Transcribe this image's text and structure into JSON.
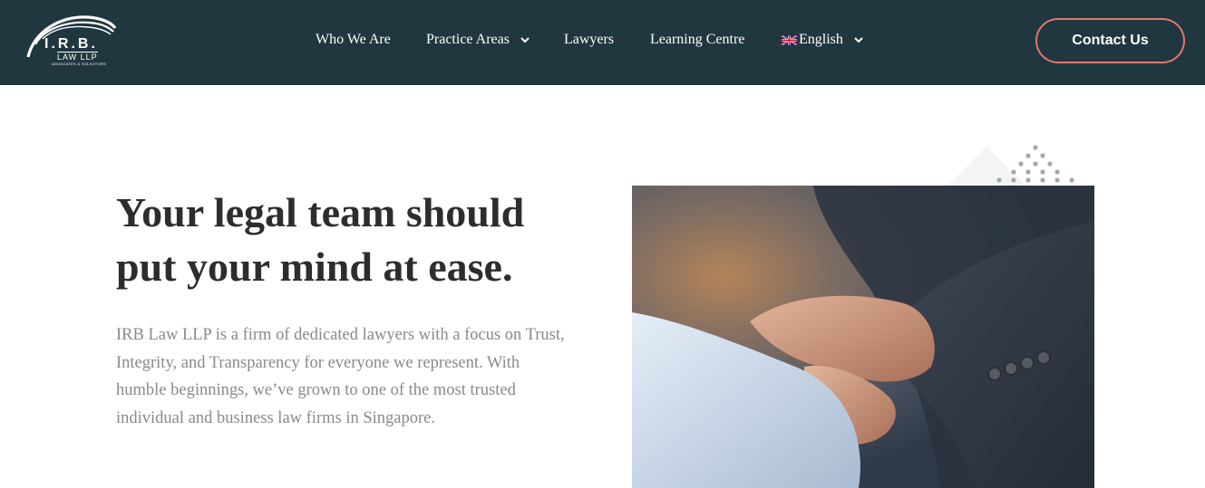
{
  "header": {
    "logo": {
      "name": "I.R.B.",
      "line2": "LAW LLP",
      "line3": "ADVOCATES & SOLICITORS"
    },
    "nav": {
      "who_we_are": "Who We Are",
      "practice_areas": "Practice Areas",
      "lawyers": "Lawyers",
      "learning_centre": "Learning Centre",
      "language": "English"
    },
    "contact_label": "Contact Us"
  },
  "hero": {
    "title": "Your legal team should put your mind at ease.",
    "description": "IRB Law LLP is a firm of dedicated lawyers with a focus on Trust, Integrity, and Transparency for everyone we represent. With humble beginnings, we’ve grown to one of the most trusted individual and business law firms in Singapore."
  },
  "colors": {
    "header_bg": "#213740",
    "accent": "#e2776f",
    "heading": "#2d2d2d",
    "body_text": "#8a8a8a"
  },
  "icons": {
    "practice_chevron": "chevron-down-icon",
    "language_chevron": "chevron-down-icon",
    "flag": "uk-flag-icon"
  }
}
